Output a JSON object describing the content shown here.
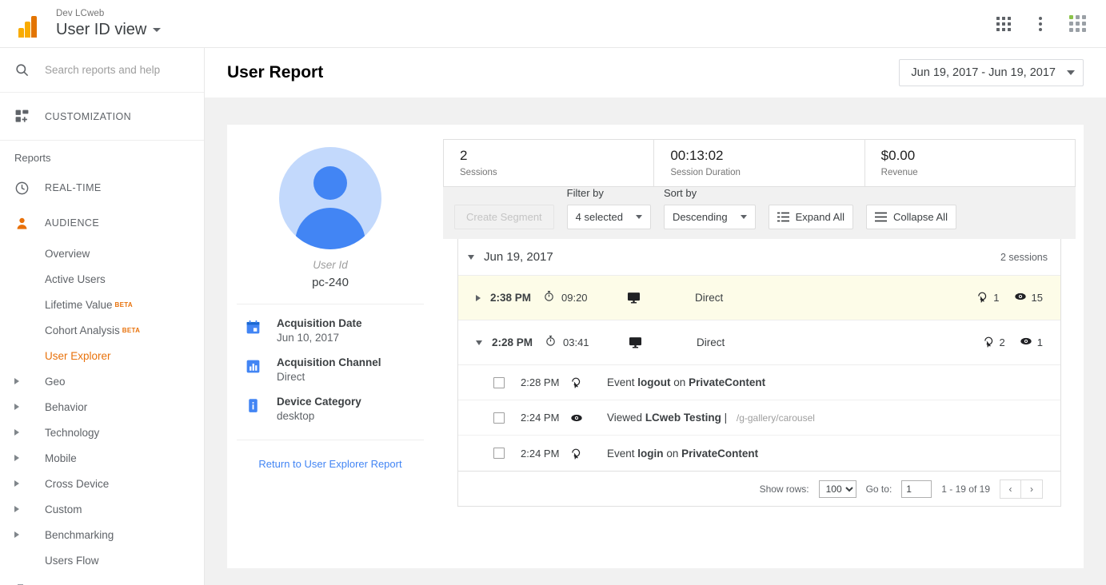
{
  "topbar": {
    "account_name": "Dev LCweb",
    "view_name": "User ID view",
    "apps_icon": "apps-grid-icon",
    "more_icon": "more-vertical-icon",
    "account_icon": "account-grid-icon"
  },
  "sidebar": {
    "search_placeholder": "Search reports and help",
    "customization_label": "CUSTOMIZATION",
    "reports_caption": "Reports",
    "top_items": [
      {
        "label": "REAL-TIME",
        "icon": "clock-icon"
      },
      {
        "label": "AUDIENCE",
        "icon": "person-icon"
      }
    ],
    "sub_items": [
      {
        "label": "Overview",
        "expandable": false,
        "active": false,
        "badge": ""
      },
      {
        "label": "Active Users",
        "expandable": false,
        "active": false,
        "badge": ""
      },
      {
        "label": "Lifetime Value",
        "expandable": false,
        "active": false,
        "badge": "BETA"
      },
      {
        "label": "Cohort Analysis",
        "expandable": false,
        "active": false,
        "badge": "BETA"
      },
      {
        "label": "User Explorer",
        "expandable": false,
        "active": true,
        "badge": ""
      },
      {
        "label": "Geo",
        "expandable": true,
        "active": false,
        "badge": ""
      },
      {
        "label": "Behavior",
        "expandable": true,
        "active": false,
        "badge": ""
      },
      {
        "label": "Technology",
        "expandable": true,
        "active": false,
        "badge": ""
      },
      {
        "label": "Mobile",
        "expandable": true,
        "active": false,
        "badge": ""
      },
      {
        "label": "Cross Device",
        "expandable": true,
        "active": false,
        "badge": ""
      },
      {
        "label": "Custom",
        "expandable": true,
        "active": false,
        "badge": ""
      },
      {
        "label": "Benchmarking",
        "expandable": true,
        "active": false,
        "badge": ""
      },
      {
        "label": "Users Flow",
        "expandable": false,
        "active": false,
        "badge": ""
      }
    ]
  },
  "report": {
    "title": "User Report",
    "date_range": "Jun 19, 2017 - Jun 19, 2017"
  },
  "profile": {
    "user_id_label": "User Id",
    "user_id_value": "pc-240",
    "attributes": [
      {
        "label": "Acquisition Date",
        "value": "Jun 10, 2017",
        "icon": "calendar-icon"
      },
      {
        "label": "Acquisition Channel",
        "value": "Direct",
        "icon": "bar-chart-icon"
      },
      {
        "label": "Device Category",
        "value": "desktop",
        "icon": "info-device-icon"
      }
    ],
    "return_link": "Return to User Explorer Report"
  },
  "metrics": [
    {
      "value": "2",
      "label": "Sessions"
    },
    {
      "value": "00:13:02",
      "label": "Session Duration"
    },
    {
      "value": "$0.00",
      "label": "Revenue"
    }
  ],
  "toolbar": {
    "create_segment": "Create Segment",
    "filter_by_label": "Filter by",
    "filter_by_value": "4 selected",
    "sort_by_label": "Sort by",
    "sort_by_value": "Descending",
    "expand_all": "Expand All",
    "collapse_all": "Collapse All"
  },
  "date_group": {
    "date": "Jun 19, 2017",
    "sessions_count": "2 sessions"
  },
  "sessions": [
    {
      "time": "2:38 PM",
      "duration": "09:20",
      "device": "desktop-monitor-icon",
      "source": "Direct",
      "events_count": "1",
      "pageviews_count": "15",
      "expanded": false,
      "highlighted": true,
      "events": []
    },
    {
      "time": "2:28 PM",
      "duration": "03:41",
      "device": "desktop-monitor-icon",
      "source": "Direct",
      "events_count": "2",
      "pageviews_count": "1",
      "expanded": true,
      "highlighted": false,
      "events": [
        {
          "time": "2:28 PM",
          "icon": "cursor-click-icon",
          "prefix": "Event",
          "bold1": "logout",
          "middle": "on",
          "bold2": "PrivateContent",
          "path": ""
        },
        {
          "time": "2:24 PM",
          "icon": "eye-icon",
          "prefix": "Viewed",
          "bold1": "LCweb Testing",
          "middle": "|",
          "bold2": "",
          "path": "/g-gallery/carousel"
        },
        {
          "time": "2:24 PM",
          "icon": "cursor-click-icon",
          "prefix": "Event",
          "bold1": "login",
          "middle": "on",
          "bold2": "PrivateContent",
          "path": ""
        }
      ]
    }
  ],
  "pager": {
    "show_rows_label": "Show rows:",
    "show_rows_value": "100",
    "goto_label": "Go to:",
    "goto_value": "1",
    "range": "1 - 19 of 19",
    "prev": "‹",
    "next": "›"
  },
  "colors": {
    "accent_orange": "#e8710a",
    "link_blue": "#4285f4",
    "highlight_row": "#fdfce8"
  }
}
